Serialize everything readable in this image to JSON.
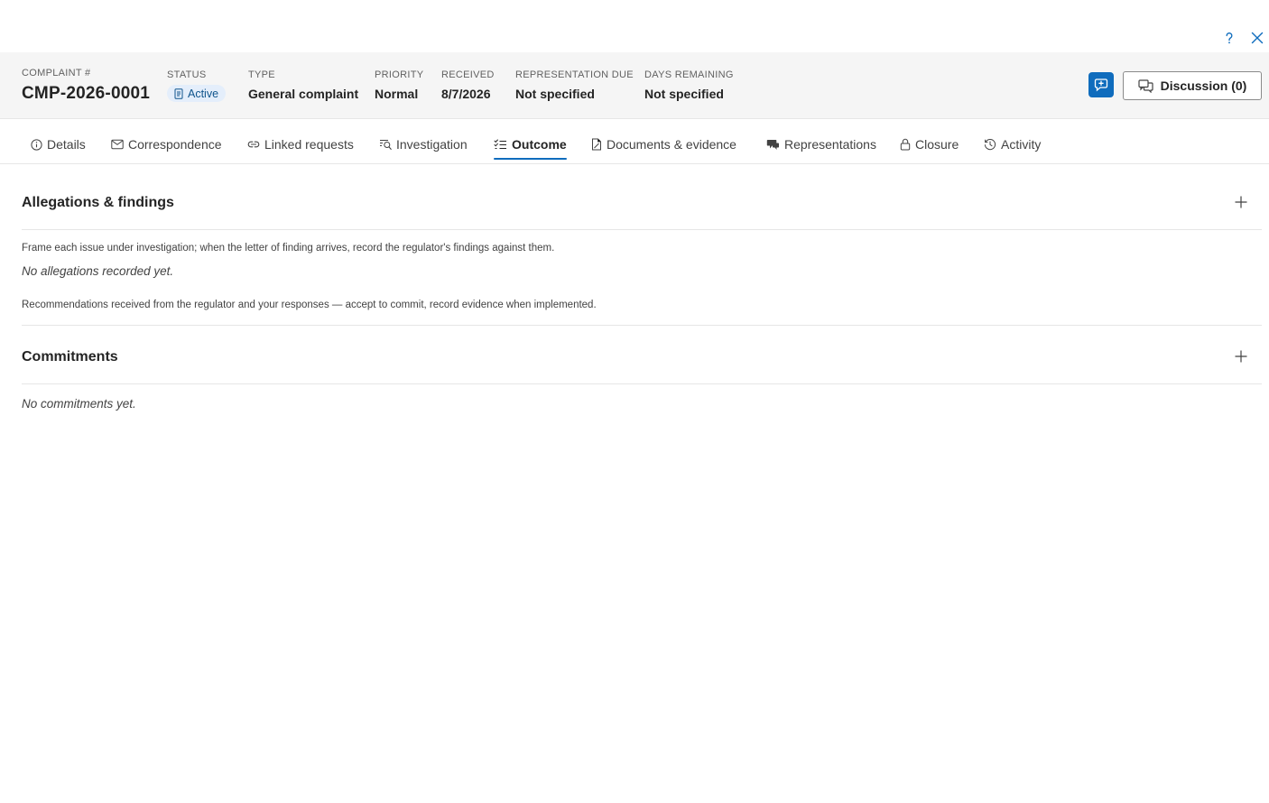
{
  "window": {
    "help_icon": "question-mark-icon",
    "close_icon": "close-icon"
  },
  "header": {
    "complaint_label": "COMPLAINT #",
    "complaint_number": "CMP-2026-0001",
    "status_label": "STATUS",
    "status_value": "Active",
    "type_label": "TYPE",
    "type_value": "General complaint",
    "priority_label": "PRIORITY",
    "priority_value": "Normal",
    "received_label": "RECEIVED",
    "received_value": "8/7/2026",
    "representation_due_label": "REPRESENTATION DUE",
    "representation_due_value": "Not specified",
    "days_remaining_label": "DAYS REMAINING",
    "days_remaining_value": "Not specified",
    "discussion_label": "Discussion (0)"
  },
  "tabs": [
    {
      "label": "Details",
      "icon": "info-icon"
    },
    {
      "label": "Correspondence",
      "icon": "mail-icon"
    },
    {
      "label": "Linked requests",
      "icon": "link-icon"
    },
    {
      "label": "Investigation",
      "icon": "investigation-icon"
    },
    {
      "label": "Outcome",
      "icon": "checklist-icon",
      "active": true
    },
    {
      "label": "Documents & evidence",
      "icon": "document-icon"
    },
    {
      "label": "Representations",
      "icon": "representations-icon"
    },
    {
      "label": "Closure",
      "icon": "lock-icon"
    },
    {
      "label": "Activity",
      "icon": "history-icon"
    }
  ],
  "allegations": {
    "title": "Allegations & findings",
    "hint": "Frame each issue under investigation; when the letter of finding arrives, record the regulator's findings against them.",
    "empty": "No allegations recorded yet."
  },
  "recommendations": {
    "hint": "Recommendations received from the regulator and your responses — accept to commit, record evidence when implemented."
  },
  "commitments": {
    "title": "Commitments",
    "empty": "No commitments yet."
  },
  "colors": {
    "accent": "#0f6cbd",
    "status_pill_bg": "#e4eefb",
    "status_pill_text": "#0f548c",
    "header_bg": "#f5f5f5"
  }
}
